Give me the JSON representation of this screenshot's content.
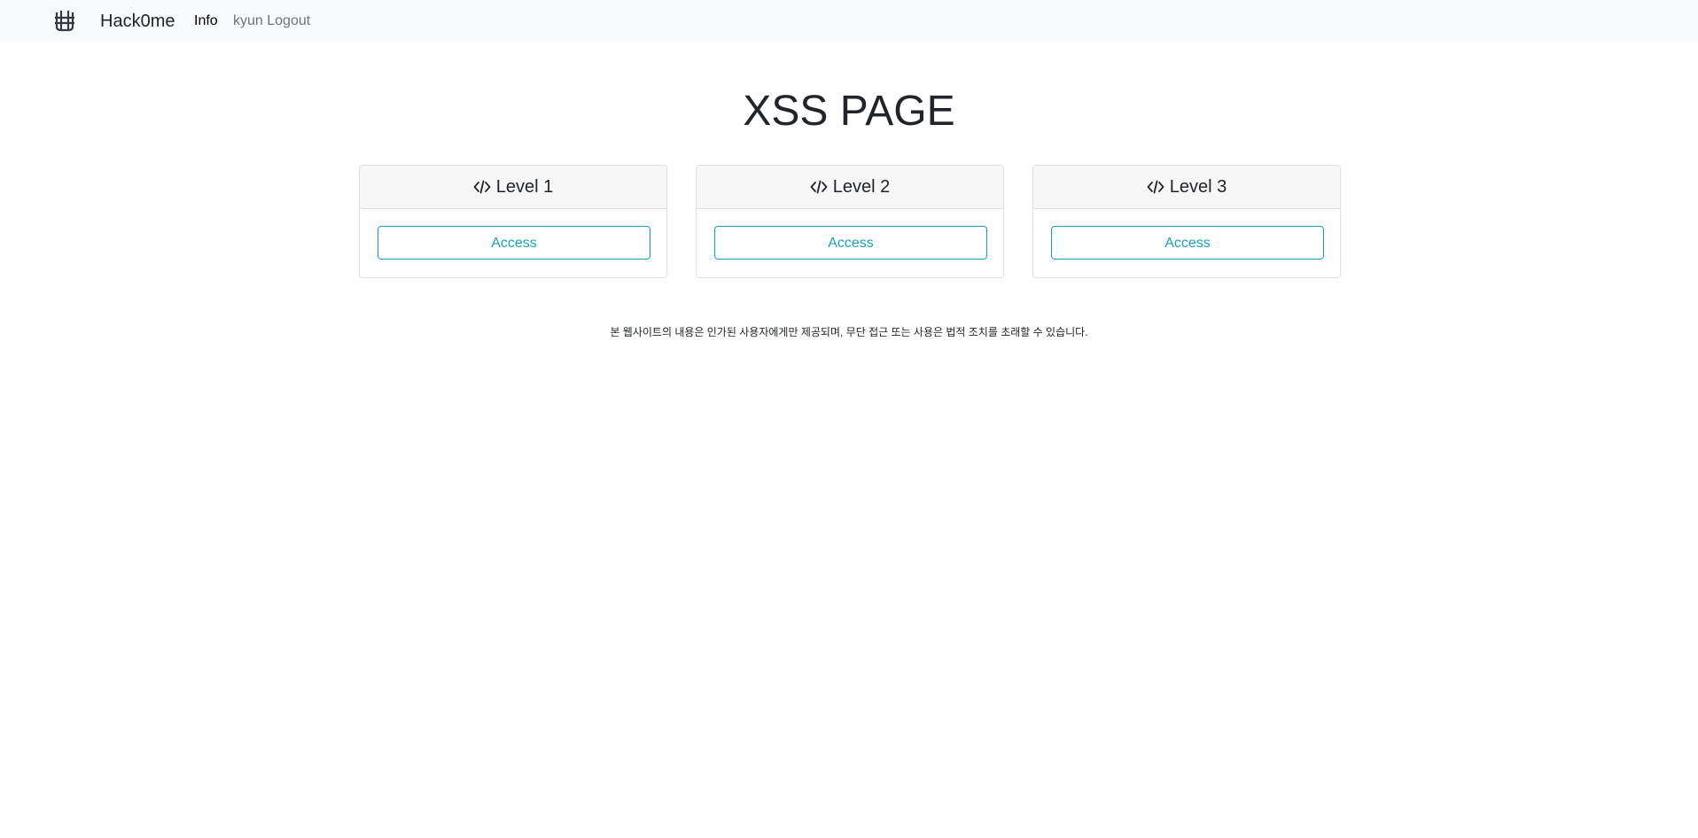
{
  "navbar": {
    "logo_icon": "brand-logo-icon",
    "brand_name": "Hack0me",
    "links": {
      "info": "Info",
      "logout": "kyun Logout"
    }
  },
  "main": {
    "title": "XSS PAGE",
    "cards": [
      {
        "icon": "code-icon",
        "title": "Level 1",
        "button_label": "Access"
      },
      {
        "icon": "code-icon",
        "title": "Level 2",
        "button_label": "Access"
      },
      {
        "icon": "code-icon",
        "title": "Level 3",
        "button_label": "Access"
      }
    ]
  },
  "footer": {
    "notice": "본 웹사이트의 내용은 인가된 사용자에게만 제공되며, 무단 접근 또는 사용은 법적 조치를 초래할 수 있습니다."
  },
  "colors": {
    "navbar_bg": "#f8f9fa",
    "accent": "#17a2b8",
    "card_header_bg": "#f7f7f7",
    "border": "#dee2e6"
  }
}
